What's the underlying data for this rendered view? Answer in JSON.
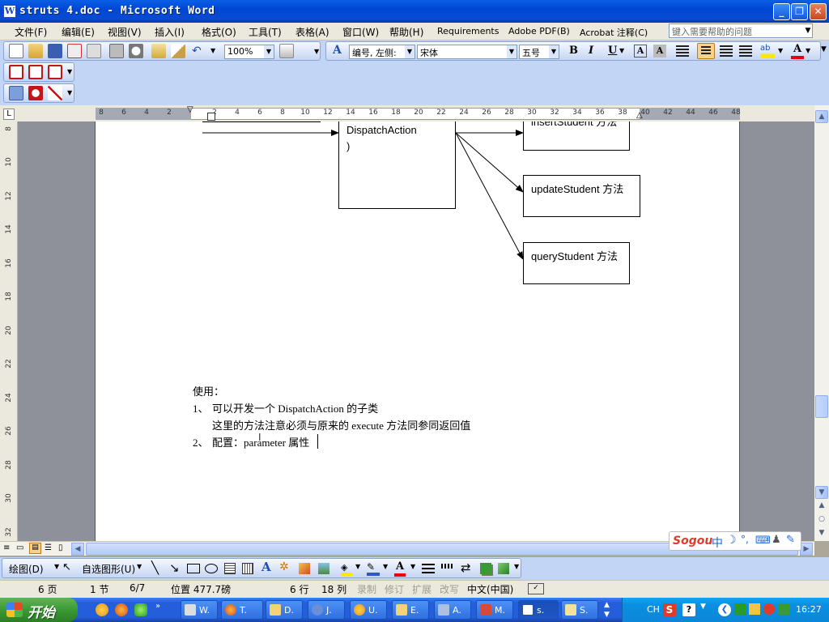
{
  "window": {
    "title": "struts 4.doc - Microsoft Word",
    "title_icon": "W"
  },
  "window_controls": [
    "_",
    "❐",
    "✕"
  ],
  "menu": [
    "文件(F)",
    "编辑(E)",
    "视图(V)",
    "插入(I)",
    "格式(O)",
    "工具(T)",
    "表格(A)",
    "窗口(W)",
    "帮助(H)",
    "Requirements",
    "Adobe PDF(B)",
    "Acrobat 注释(C)"
  ],
  "help_search": {
    "placeholder": "键入需要帮助的问题"
  },
  "toolbar": {
    "zoom": "100%",
    "style": "编号, 左侧:",
    "font": "宋体",
    "size": "五号"
  },
  "ruler": {
    "h_ticks": [
      "8",
      "6",
      "4",
      "2",
      "2",
      "4",
      "6",
      "8",
      "10",
      "12",
      "14",
      "16",
      "18",
      "20",
      "22",
      "24",
      "26",
      "28",
      "30",
      "32",
      "34",
      "36",
      "38",
      "40",
      "42",
      "44",
      "46",
      "48"
    ],
    "v_ticks": [
      "8",
      "10",
      "12",
      "14",
      "16",
      "18",
      "20",
      "22",
      "24",
      "26",
      "28",
      "30",
      "32"
    ]
  },
  "diagram": {
    "center_box": [
      "DispatchAction",
      ")"
    ],
    "top_box": "insertStudent 方法",
    "update_box": "updateStudent 方法",
    "query_box": "queryStudent 方法"
  },
  "document": {
    "usage_label": "使用：",
    "items": [
      {
        "num": "1、",
        "text": "可以开发一个 DispatchAction 的子类"
      },
      {
        "num": "",
        "text": "这里的方法注意必须与原来的 execute 方法同参同返回值"
      },
      {
        "num": "2、",
        "text": "配置：parameter 属性"
      }
    ]
  },
  "draw_toolbar": {
    "draw_label": "绘图(D)",
    "autoshape_label": "自选图形(U)"
  },
  "ime_bar": {
    "logo": "Sogou",
    "mode": "中"
  },
  "status": {
    "page": "6 页",
    "section": "1 节",
    "page_of": "6/7",
    "position": "位置 477.7磅",
    "line": "6 行",
    "column": "18 列",
    "rec": "录制",
    "trk": "修订",
    "ext": "扩展",
    "ovr": "改写",
    "language": "中文(中国)"
  },
  "taskbar": {
    "start_label": "开始",
    "items": [
      "W.",
      "T.",
      "D.",
      "J.",
      "U.",
      "E.",
      "A.",
      "M.",
      "s.",
      "S."
    ],
    "lang": "CH",
    "clock": "16:27"
  }
}
